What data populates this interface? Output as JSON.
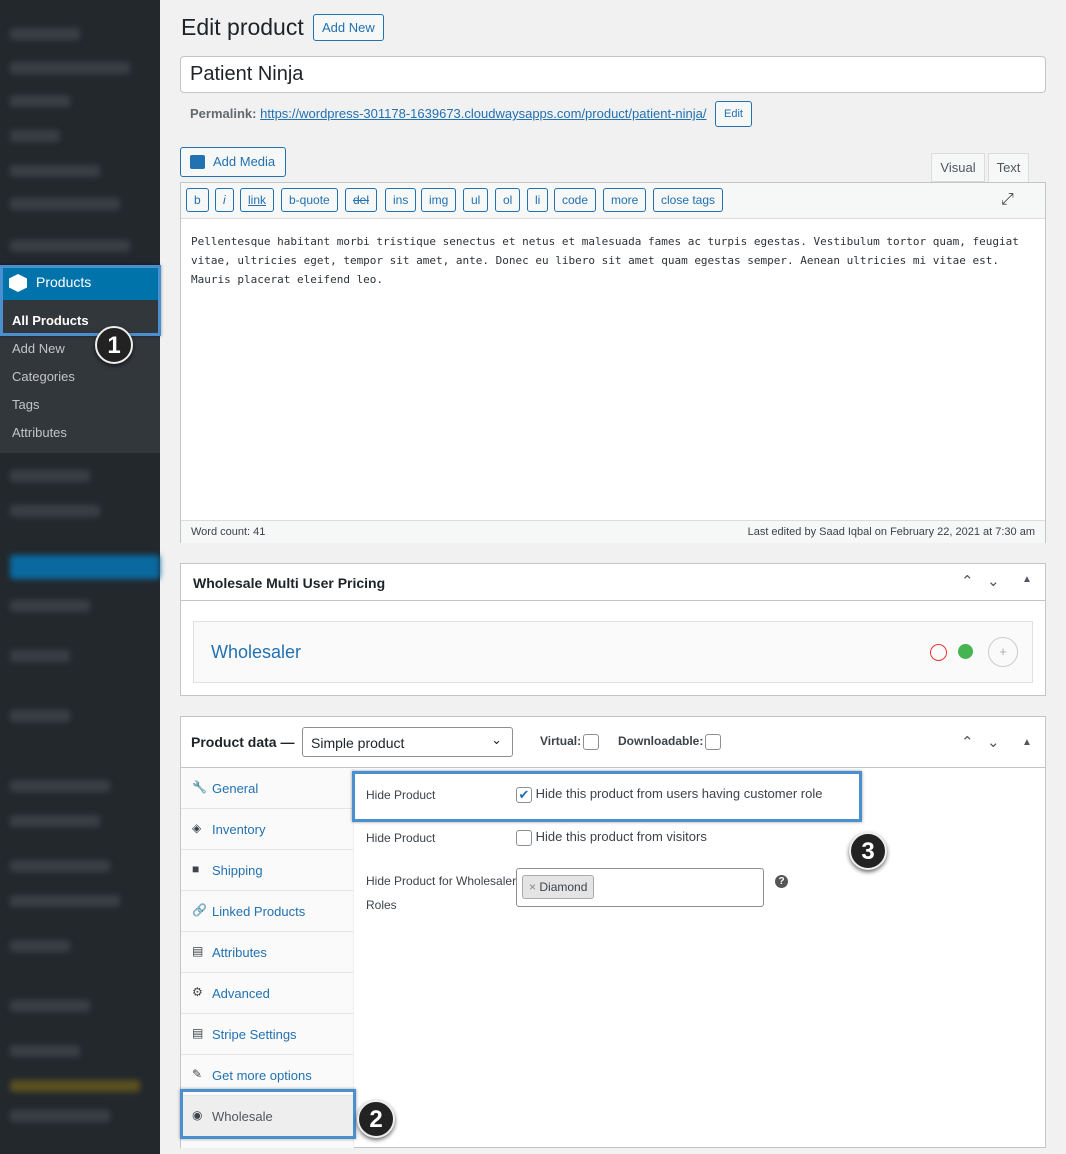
{
  "sidebar": {
    "products": "Products",
    "items": [
      "All Products",
      "Add New",
      "Categories",
      "Tags",
      "Attributes"
    ]
  },
  "header": {
    "title": "Edit product",
    "add_new": "Add New"
  },
  "post_title": "Patient Ninja",
  "permalink": {
    "label": "Permalink:",
    "url": "https://wordpress-301178-1639673.cloudwaysapps.com/product/patient-ninja/",
    "edit": "Edit"
  },
  "editor": {
    "add_media": "Add Media",
    "tabs": [
      "Visual",
      "Text"
    ],
    "quicktags": [
      "b",
      "i",
      "link",
      "b-quote",
      "del",
      "ins",
      "img",
      "ul",
      "ol",
      "li",
      "code",
      "more",
      "close tags"
    ],
    "content": "Pellentesque habitant morbi tristique senectus et netus et malesuada fames ac turpis egestas. Vestibulum tortor quam, feugiat vitae, ultricies eget, tempor sit amet, ante. Donec eu libero sit amet quam egestas semper. Aenean ultricies mi vitae est. Mauris placerat eleifend leo.",
    "word_count": "Word count: 41",
    "last_edited": "Last edited by Saad Iqbal on February 22, 2021 at 7:30 am"
  },
  "wholesale_box": {
    "title": "Wholesale Multi User Pricing",
    "role": "Wholesaler"
  },
  "product_data": {
    "title": "Product data —",
    "type": "Simple product",
    "virtual": "Virtual:",
    "downloadable": "Downloadable:",
    "tabs": [
      "General",
      "Inventory",
      "Shipping",
      "Linked Products",
      "Attributes",
      "Advanced",
      "Stripe Settings",
      "Get more options",
      "Wholesale"
    ],
    "fields": {
      "hide1_label": "Hide Product",
      "hide1_text": "Hide this product from users having customer role",
      "hide2_label": "Hide Product",
      "hide2_text": "Hide this product from visitors",
      "roles_label1": "Hide Product for Wholesaler",
      "roles_label2": "Roles",
      "tag": "Diamond",
      "tag_x": "×"
    }
  },
  "badges": [
    "1",
    "2",
    "3"
  ]
}
